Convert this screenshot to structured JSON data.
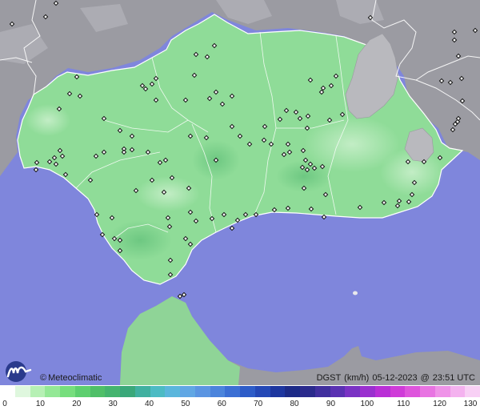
{
  "map": {
    "brand": "Meteoclimatic",
    "copyright_symbol": "©",
    "variable": "DGST",
    "unit": "(km/h)",
    "date": "05-12-2023",
    "at": "@",
    "time": "23:51 UTC",
    "colors": {
      "sea": "#7f86dc",
      "land_outside": "#9a9aa0",
      "mountains": "#bdbdc1",
      "region_fill": "#8fdc98",
      "region_light": "#b2e8b8",
      "borders": "#ffffff",
      "station": "#111111"
    }
  },
  "legend": {
    "ticks": [
      "0",
      "10",
      "20",
      "30",
      "40",
      "50",
      "60",
      "70",
      "80",
      "90",
      "100",
      "110",
      "120",
      "130"
    ],
    "colors": [
      "#ffffff",
      "#dff7de",
      "#b6f0b4",
      "#94e896",
      "#76de7d",
      "#5dcf6f",
      "#4fbf68",
      "#44b46e",
      "#3aa87a",
      "#40b0a0",
      "#4cbbc4",
      "#5ab6dc",
      "#61a7e4",
      "#5b95e2",
      "#4b84dc",
      "#3b6fd4",
      "#2d5cc8",
      "#2448b6",
      "#1d369f",
      "#1c2a87",
      "#2a2a8c",
      "#402f9e",
      "#5a31b2",
      "#7a32c4",
      "#9a30cf",
      "#b92fd6",
      "#cf3cd8",
      "#de55dc",
      "#e874e2",
      "#ef93e8",
      "#f4b2ef",
      "#f8d0f5"
    ]
  }
}
